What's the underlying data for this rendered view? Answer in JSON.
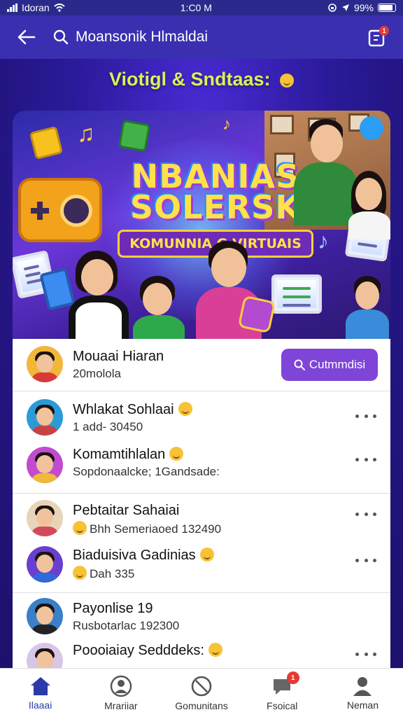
{
  "status_bar": {
    "carrier": "Idoran",
    "time": "1:C0 M",
    "battery": "99%"
  },
  "header": {
    "search_text": "Moansonik Hlmaldai",
    "notification_count": "1"
  },
  "section_heading": "Viotigl & Sndtaas:",
  "banner": {
    "title_line1": "NBANIAS",
    "title_line2": "SOLERSK",
    "subtitle": "KOMUNNIA G VIRTUAIS"
  },
  "list": {
    "top": {
      "name": "Mouaai Hiaran",
      "sub": "20molola",
      "button_label": "Cutmmdisi"
    },
    "rows": [
      {
        "name": "Whlakat Sohlaai",
        "sub": "1 add- 30450"
      },
      {
        "name": "Komamtihlalan",
        "sub": "Sopdonaalcke; 1Gandsade:"
      },
      {
        "name": "Pebtaitar Sahaiai",
        "sub": "Bhh Semeriaoed 132490"
      },
      {
        "name": "Biaduisiva Gadinias",
        "sub": "Dah 335"
      },
      {
        "name": "Payonlise 19",
        "sub": "Rusbotarlac 192300"
      },
      {
        "name": "Poooiaiay Sedddeks:",
        "sub": ""
      }
    ]
  },
  "bottom_nav": {
    "items": [
      {
        "label": "Ilaaai",
        "icon": "home-icon"
      },
      {
        "label": "Mrariiar",
        "icon": "profile-icon"
      },
      {
        "label": "Gomunitans",
        "icon": "community-icon"
      },
      {
        "label": "Fsoical",
        "icon": "social-icon",
        "badge": "1"
      },
      {
        "label": "Neman",
        "icon": "user-icon"
      }
    ]
  },
  "colors": {
    "header_bg": "#3a2fb0",
    "accent": "#7e45d8",
    "heading": "#d8f25a",
    "badge": "#e53935"
  }
}
